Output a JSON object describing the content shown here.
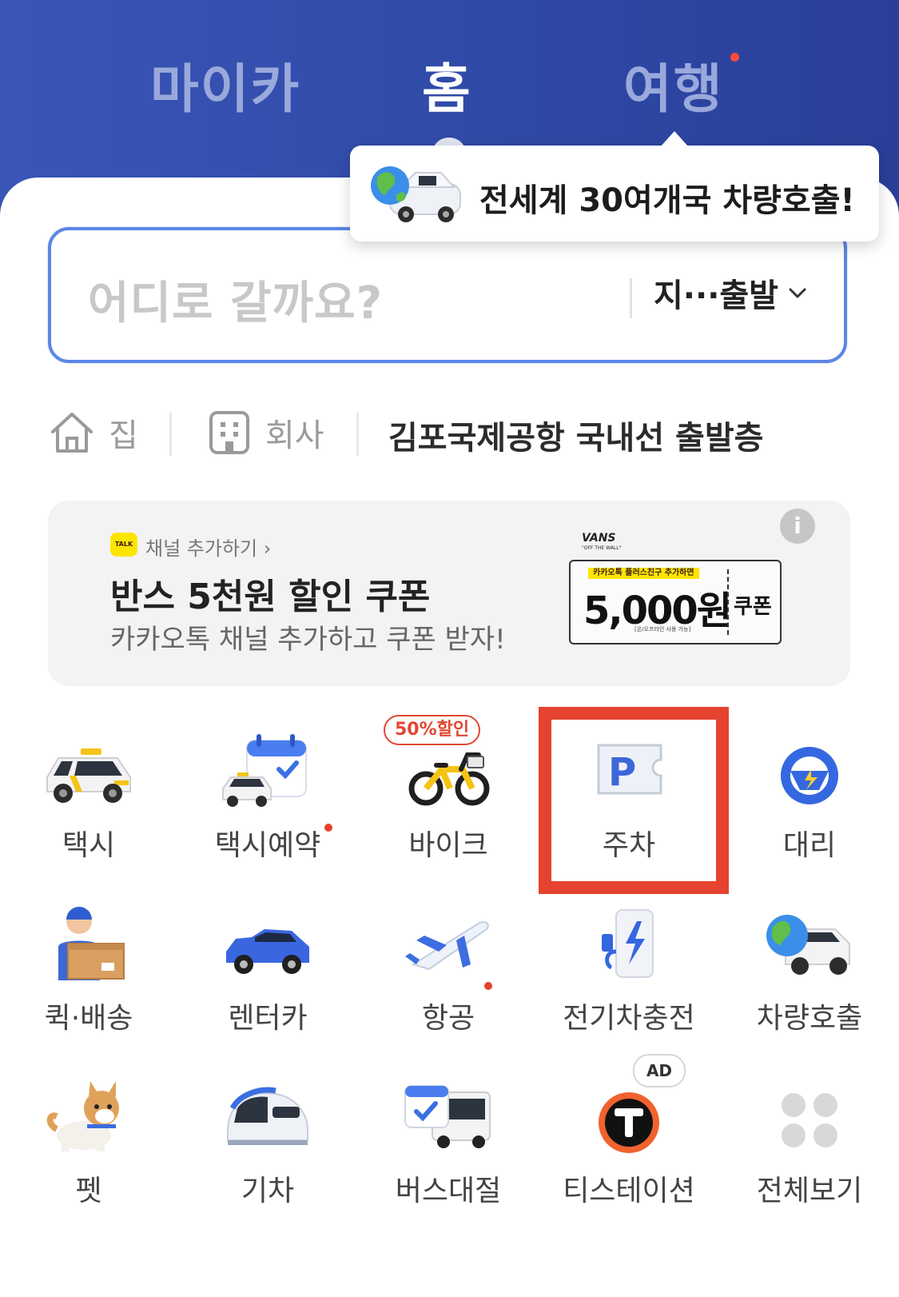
{
  "tabs": [
    {
      "label": "마이카",
      "active": false
    },
    {
      "label": "홈",
      "active": true
    },
    {
      "label": "여행",
      "active": false,
      "has_new_dot": true
    }
  ],
  "tooltip": {
    "text": "전세계 30여개국 차량호출!",
    "icon": "globe-car-icon"
  },
  "search": {
    "placeholder": "어디로 갈까요?",
    "depart_option": "지···출발"
  },
  "shortcuts": {
    "home": {
      "label": "집",
      "icon": "house-icon"
    },
    "work": {
      "label": "회사",
      "icon": "building-icon"
    },
    "recent": "김포국제공항 국내선 출발층"
  },
  "banner": {
    "channel": "채널 추가하기 ›",
    "title": "반스 5천원 할인 쿠폰",
    "subtitle": "카카오톡 채널 추가하고 쿠폰 받자!",
    "brand": "VANS",
    "brand_sub": "\"OFF THE WALL\"",
    "talk_badge": "TALK",
    "coupon": {
      "header": "카카오톡 플러스친구 추가하면",
      "amount": "5,000원",
      "kind": "쿠폰",
      "note": "[온/오프라인 사용 가능]"
    }
  },
  "services": [
    {
      "label": "택시",
      "icon": "taxi-icon"
    },
    {
      "label": "택시예약",
      "icon": "taxi-reservation-icon",
      "has_new_dot": true
    },
    {
      "label": "바이크",
      "icon": "bike-icon",
      "badge": "50%할인"
    },
    {
      "label": "주차",
      "icon": "parking-icon",
      "highlighted": true
    },
    {
      "label": "대리",
      "icon": "steering-wheel-icon"
    },
    {
      "label": "퀵·배송",
      "icon": "courier-icon"
    },
    {
      "label": "렌터카",
      "icon": "rental-car-icon"
    },
    {
      "label": "항공",
      "icon": "airplane-icon",
      "has_new_dot": true
    },
    {
      "label": "전기차충전",
      "icon": "ev-charger-icon"
    },
    {
      "label": "차량호출",
      "icon": "globe-car-icon"
    },
    {
      "label": "펫",
      "icon": "dog-icon"
    },
    {
      "label": "기차",
      "icon": "train-icon"
    },
    {
      "label": "버스대절",
      "icon": "bus-icon"
    },
    {
      "label": "티스테이션",
      "icon": "t-station-icon",
      "badge": "AD"
    },
    {
      "label": "전체보기",
      "icon": "view-all-icon"
    }
  ],
  "colors": {
    "header_blue": "#2f4aa6",
    "search_border": "#5b86e6",
    "highlight_red": "#e5422f",
    "kakao_yellow": "#fee500"
  }
}
